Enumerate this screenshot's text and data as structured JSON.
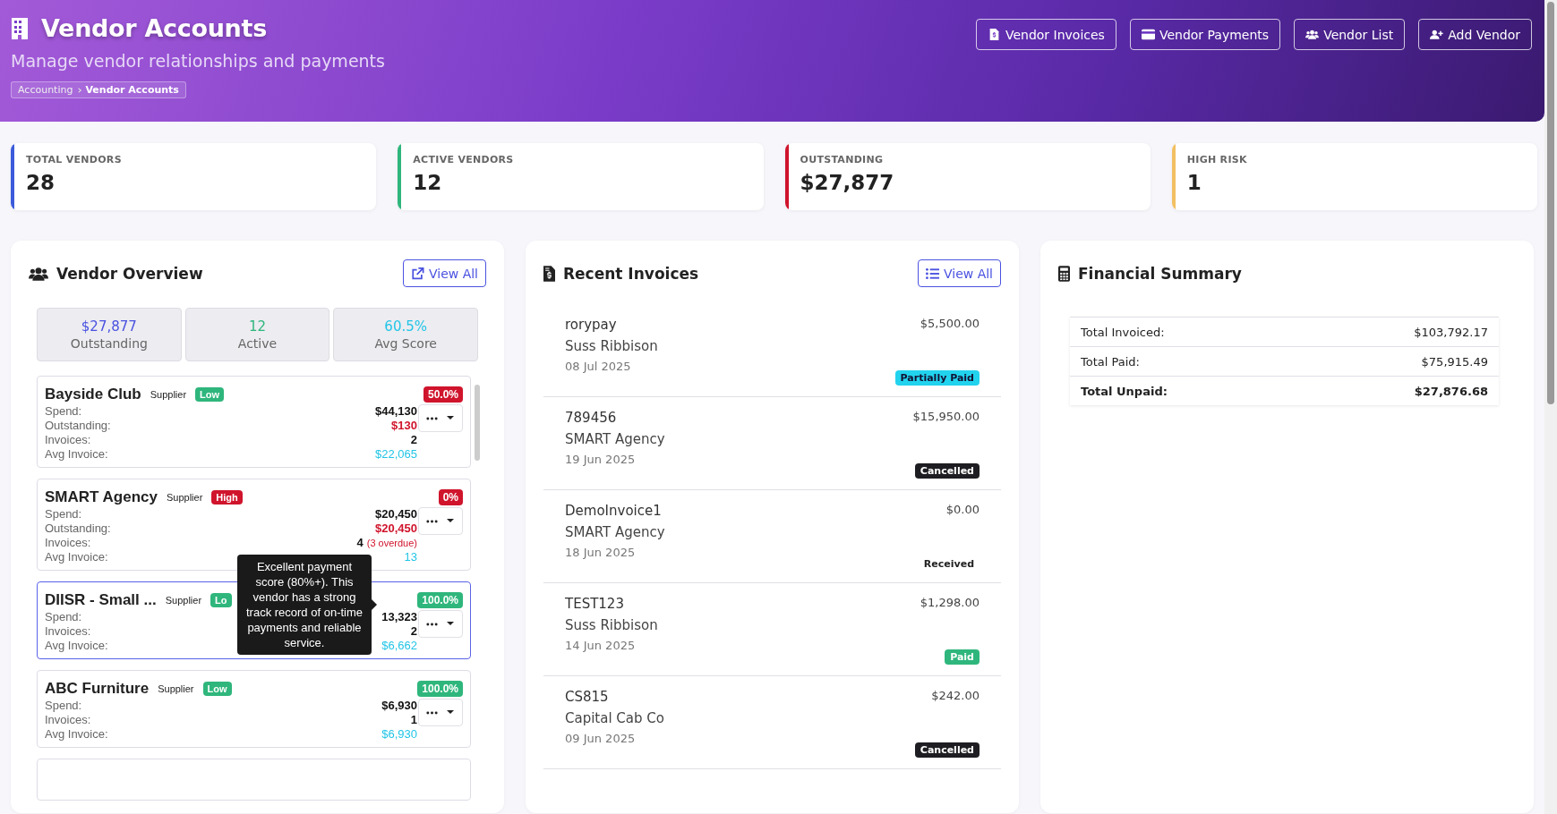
{
  "header": {
    "title": "Vendor Accounts",
    "subtitle": "Manage vendor relationships and payments",
    "breadcrumb": [
      {
        "label": "Accounting",
        "current": false
      },
      {
        "label": "Vendor Accounts",
        "current": true
      }
    ],
    "actions": [
      "Vendor Invoices",
      "Vendor Payments",
      "Vendor List",
      "Add Vendor"
    ]
  },
  "stats": [
    {
      "label": "TOTAL VENDORS",
      "value": "28",
      "color": "#3b5bdb"
    },
    {
      "label": "ACTIVE VENDORS",
      "value": "12",
      "color": "#2fb67c"
    },
    {
      "label": "OUTSTANDING",
      "value": "$27,877",
      "color": "#d0142c"
    },
    {
      "label": "HIGH RISK",
      "value": "1",
      "color": "#f2c063"
    }
  ],
  "vendor_overview": {
    "title": "Vendor Overview",
    "view_all": "View All",
    "summary": [
      {
        "value": "$27,877",
        "label": "Outstanding",
        "color": "#4a52e0"
      },
      {
        "value": "12",
        "label": "Active",
        "color": "#2fb67c"
      },
      {
        "value": "60.5%",
        "label": "Avg Score",
        "color": "#22c5e6"
      }
    ],
    "vendors": [
      {
        "name": "Bayside Club",
        "type": "Supplier",
        "risk": {
          "label": "Low",
          "kind": "low"
        },
        "score": {
          "label": "50.0%",
          "kind": "bad"
        },
        "selected": false,
        "rows": [
          {
            "label": "Spend:",
            "value": "$44,130",
            "kind": "spend"
          },
          {
            "label": "Outstanding:",
            "value": "$130",
            "kind": "outstanding"
          },
          {
            "label": "Invoices:",
            "value": "2",
            "kind": "count"
          },
          {
            "label": "Avg Invoice:",
            "value": "$22,065",
            "kind": "avg"
          }
        ]
      },
      {
        "name": "SMART Agency",
        "type": "Supplier",
        "risk": {
          "label": "High",
          "kind": "high"
        },
        "score": {
          "label": "0%",
          "kind": "bad"
        },
        "selected": false,
        "rows": [
          {
            "label": "Spend:",
            "value": "$20,450",
            "kind": "spend"
          },
          {
            "label": "Outstanding:",
            "value": "$20,450",
            "kind": "outstanding"
          },
          {
            "label": "Invoices:",
            "value": "4",
            "note": "(3 overdue)",
            "kind": "count"
          },
          {
            "label": "Avg Invoice:",
            "value": "13",
            "kind": "avg"
          }
        ]
      },
      {
        "name": "DIISR - Small ...",
        "type": "Supplier",
        "risk": {
          "label": "Lo",
          "kind": "low"
        },
        "score": {
          "label": "100.0%",
          "kind": "good"
        },
        "selected": true,
        "tooltip": "Excellent payment score (80%+). This vendor has a strong track record of on-time payments and reliable service.",
        "rows": [
          {
            "label": "Spend:",
            "value": "13,323",
            "kind": "spend"
          },
          {
            "label": "Invoices:",
            "value": "2",
            "kind": "count"
          },
          {
            "label": "Avg Invoice:",
            "value": "$6,662",
            "kind": "avg"
          }
        ]
      },
      {
        "name": "ABC Furniture",
        "type": "Supplier",
        "risk": {
          "label": "Low",
          "kind": "low"
        },
        "score": {
          "label": "100.0%",
          "kind": "good"
        },
        "selected": false,
        "rows": [
          {
            "label": "Spend:",
            "value": "$6,930",
            "kind": "spend"
          },
          {
            "label": "Invoices:",
            "value": "1",
            "kind": "count"
          },
          {
            "label": "Avg Invoice:",
            "value": "$6,930",
            "kind": "avg"
          }
        ]
      }
    ]
  },
  "recent_invoices": {
    "title": "Recent Invoices",
    "view_all": "View All",
    "invoices": [
      {
        "number": "rorypay",
        "vendor": "Suss Ribbison",
        "date": "08 Jul 2025",
        "amount": "$5,500.00",
        "status": {
          "label": "Partially Paid",
          "kind": "partial"
        }
      },
      {
        "number": "789456",
        "vendor": "SMART Agency",
        "date": "19 Jun 2025",
        "amount": "$15,950.00",
        "status": {
          "label": "Cancelled",
          "kind": "cancelled"
        }
      },
      {
        "number": "DemoInvoice1",
        "vendor": "SMART Agency",
        "date": "18 Jun 2025",
        "amount": "$0.00",
        "status": {
          "label": "Received",
          "kind": "received"
        }
      },
      {
        "number": "TEST123",
        "vendor": "Suss Ribbison",
        "date": "14 Jun 2025",
        "amount": "$1,298.00",
        "status": {
          "label": "Paid",
          "kind": "paid"
        }
      },
      {
        "number": "CS815",
        "vendor": "Capital Cab Co",
        "date": "09 Jun 2025",
        "amount": "$242.00",
        "status": {
          "label": "Cancelled",
          "kind": "cancelled"
        }
      }
    ]
  },
  "financial_summary": {
    "title": "Financial Summary",
    "rows": [
      {
        "label": "Total Invoiced:",
        "value": "$103,792.17",
        "total": false
      },
      {
        "label": "Total Paid:",
        "value": "$75,915.49",
        "total": false
      },
      {
        "label": "Total Unpaid:",
        "value": "$27,876.68",
        "total": true
      }
    ]
  }
}
